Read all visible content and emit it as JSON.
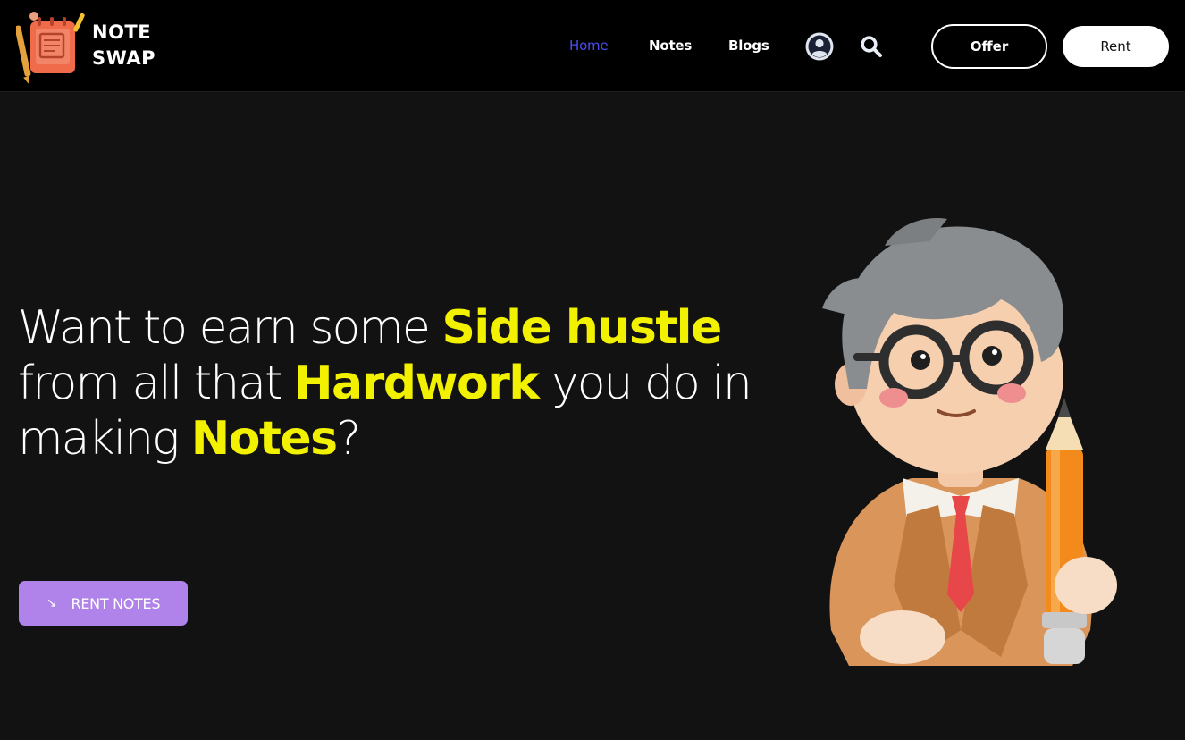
{
  "brand": {
    "line1": "NOTE",
    "line2": "SWAP",
    "logo_icon": "notepad-pencil-logo"
  },
  "nav": {
    "items": [
      {
        "label": "Home",
        "active": true
      },
      {
        "label": "Notes",
        "active": false
      },
      {
        "label": "Blogs",
        "active": false
      }
    ],
    "user_icon": "user-circle-icon",
    "search_icon": "search-icon",
    "offer_label": "Offer",
    "rent_label": "Rent"
  },
  "hero": {
    "heading": {
      "p1": "Want to earn some ",
      "h1": "Side hustle",
      "p2": " from all that ",
      "h2": "Hardwork",
      "p3": " you do in making ",
      "h3": "Notes",
      "p4": "?"
    },
    "cta_icon": "arrow-down-right-icon",
    "cta_label": "RENT NOTES",
    "illustration": "clay-student-with-glasses-and-pencil"
  },
  "colors": {
    "background": "#121212",
    "navbar": "#000000",
    "accent_yellow": "#f2f200",
    "nav_active": "#4a4df0",
    "cta_purple": "#b083ea"
  }
}
